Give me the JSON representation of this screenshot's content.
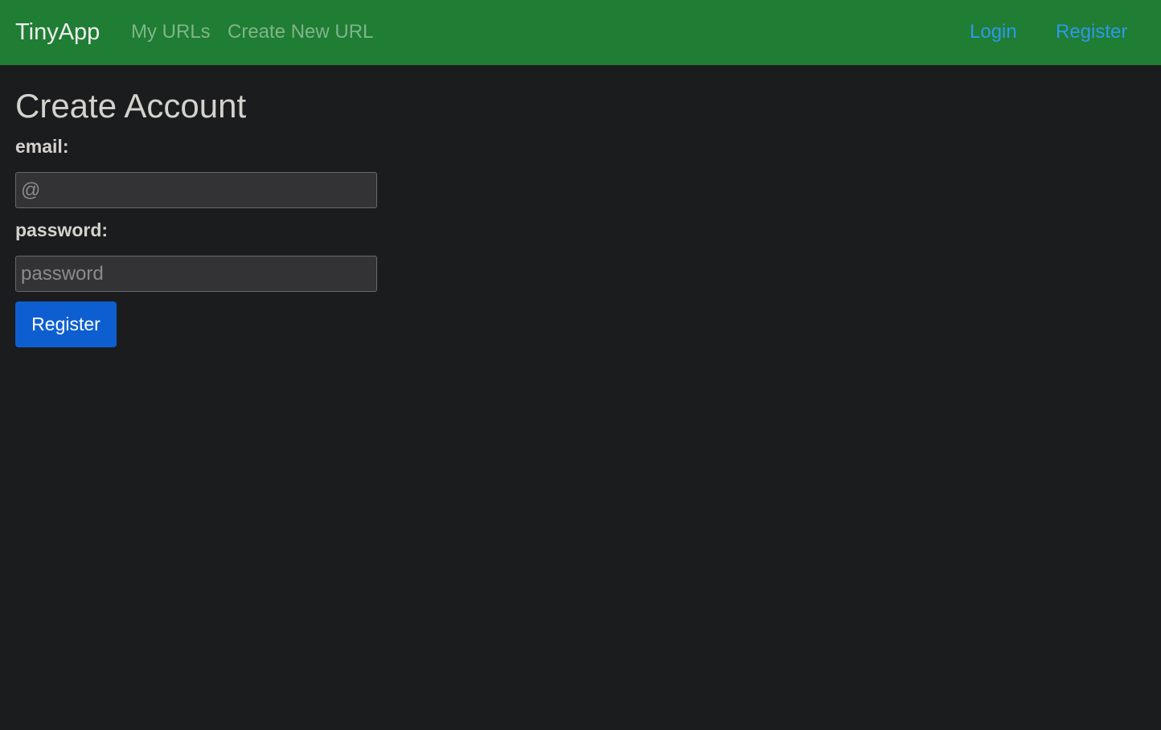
{
  "navbar": {
    "brand": "TinyApp",
    "links": {
      "my_urls": "My URLs",
      "create_new_url": "Create New URL",
      "login": "Login",
      "register": "Register"
    },
    "background_color": "#207d34"
  },
  "main": {
    "title": "Create Account",
    "email": {
      "label": "email:",
      "placeholder": "@",
      "value": ""
    },
    "password": {
      "label": "password:",
      "placeholder": "password",
      "value": ""
    },
    "submit_label": "Register",
    "submit_color": "#0d5fd1"
  }
}
